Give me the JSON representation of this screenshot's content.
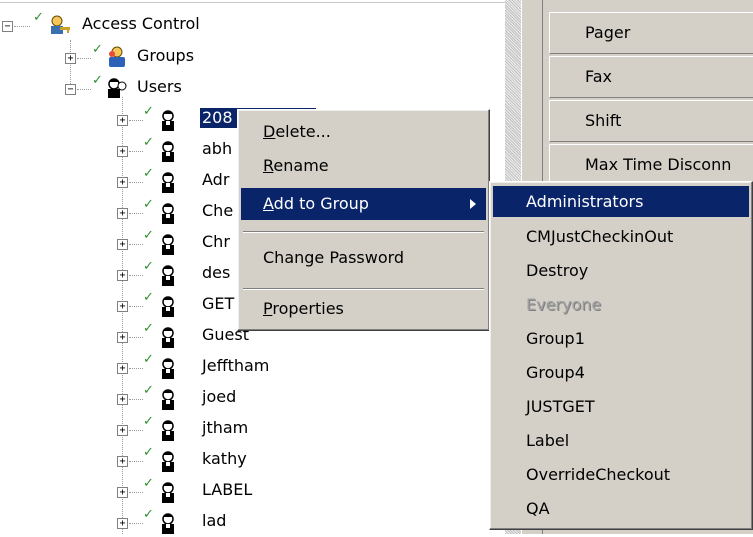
{
  "tree": {
    "root_label": "Access Control",
    "groups_label": "Groups",
    "users_label": "Users",
    "users": [
      "208",
      "abh",
      "Adr",
      "Che",
      "Chr",
      "des",
      "GET",
      "Guest",
      "Jefftham",
      "joed",
      "jtham",
      "kathy",
      "LABEL",
      "lad"
    ]
  },
  "right_panel": {
    "fields": [
      "Pager",
      "Fax",
      "Shift",
      "Max Time Disconn"
    ]
  },
  "context_menu": {
    "delete_label": "Delete...",
    "delete_mnemonic": "D",
    "delete_rest": "elete...",
    "rename_mnemonic": "R",
    "rename_rest": "ename",
    "add_to_group_mnemonic": "A",
    "add_to_group_rest": "dd to Group",
    "change_password_label": "Change Password",
    "properties_mnemonic": "P",
    "properties_rest": "roperties"
  },
  "submenu": {
    "items": [
      "Administrators",
      "CMJustCheckinOut",
      "Destroy",
      "Everyone",
      "Group1",
      "Group4",
      "JUSTGET",
      "Label",
      "OverrideCheckout",
      "QA"
    ]
  },
  "colors": {
    "selection": "#0a246a",
    "face": "#d4d0c8",
    "check": "#2f8f2f"
  }
}
